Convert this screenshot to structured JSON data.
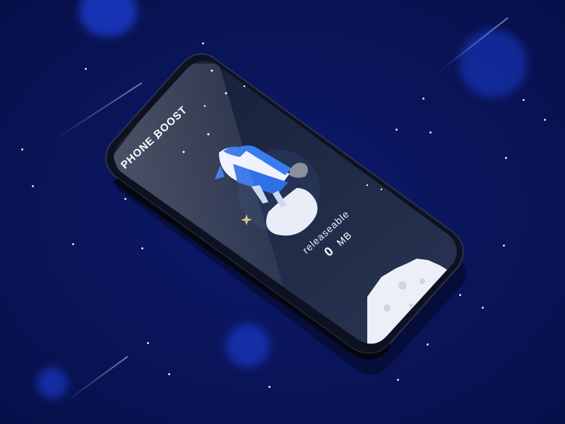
{
  "app": {
    "title": "PHONE BOOST"
  },
  "boost": {
    "label": "releaseable",
    "value": "0",
    "unit": "MB"
  },
  "colors": {
    "background": "#0a1458",
    "screen": "#1e2740",
    "rocket_blue": "#2f6fe8",
    "rocket_white": "#eef2ff",
    "moon": "#eceff8",
    "accent_star": "#c8c07a"
  },
  "icons": [
    "space-shuttle-icon",
    "moon-surface-icon",
    "star-sparkle-icon"
  ]
}
